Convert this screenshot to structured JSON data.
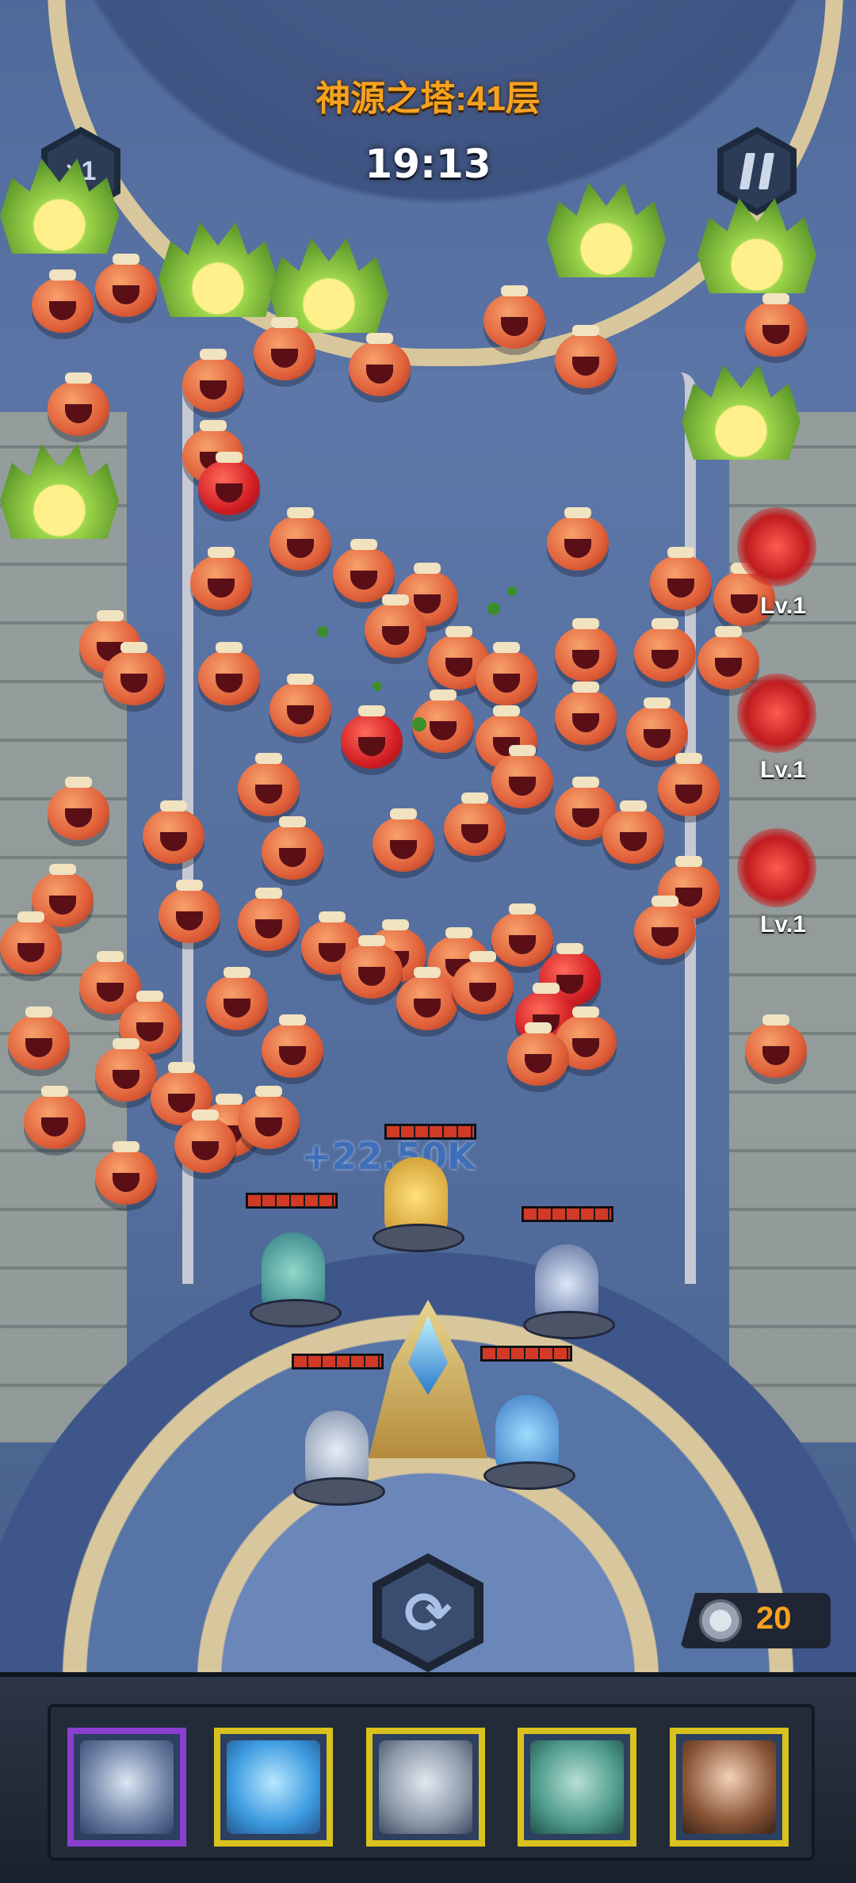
{
  "hud": {
    "floor_title": "神源之塔:41层",
    "timer": "19:13",
    "speed_label": "×1",
    "speed_icon": "speed-multiplier-icon",
    "pause_icon": "pause-icon"
  },
  "battle": {
    "damage_popup": "+22.50K",
    "enemy_levels": [
      "Lv.1",
      "Lv.1",
      "Lv.1"
    ]
  },
  "currency": {
    "icon": "silver-coin-icon",
    "amount": "20"
  },
  "refresh": {
    "icon": "refresh-icon"
  },
  "hero_cards": [
    {
      "name": "mech-hero-card",
      "selected": true
    },
    {
      "name": "fishbowl-hero-card",
      "selected": false
    },
    {
      "name": "robot-hero-card",
      "selected": false
    },
    {
      "name": "medusa-hero-card",
      "selected": false
    },
    {
      "name": "goddess-hero-card",
      "selected": false
    }
  ],
  "colors": {
    "title": "#f7a21f",
    "coin_text": "#f6a21e",
    "card_border": "#d9c21d",
    "card_selected_border": "#8a3fd0",
    "hp_bar": "#d23a26"
  }
}
